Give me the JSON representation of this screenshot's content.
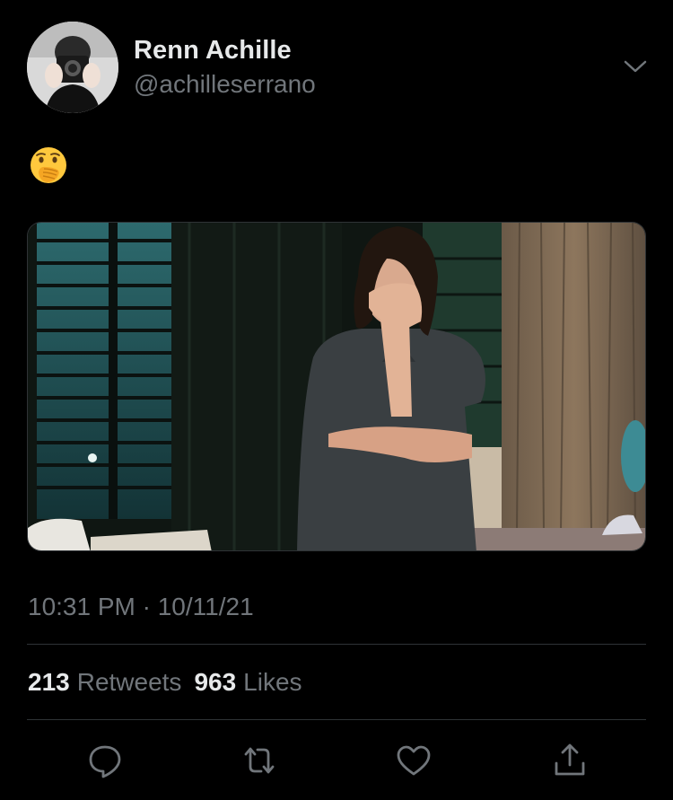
{
  "author": {
    "display_name": "Renn Achille",
    "handle": "@achilleserrano",
    "avatar": "profile-photo"
  },
  "tweet": {
    "text_emoji": "face-with-hand-over-mouth",
    "media": "photo-woman-covering-mouth",
    "timestamp": "10:31 PM · 10/11/21"
  },
  "stats": {
    "retweets_count": "213",
    "retweets_label": "Retweets",
    "likes_count": "963",
    "likes_label": "Likes"
  },
  "actions": [
    "reply-icon",
    "retweet-icon",
    "like-icon",
    "share-icon"
  ],
  "colors": {
    "background": "#000000",
    "primary_text": "#e7e9ea",
    "secondary_text": "#71767b",
    "divider": "#2f3336"
  }
}
